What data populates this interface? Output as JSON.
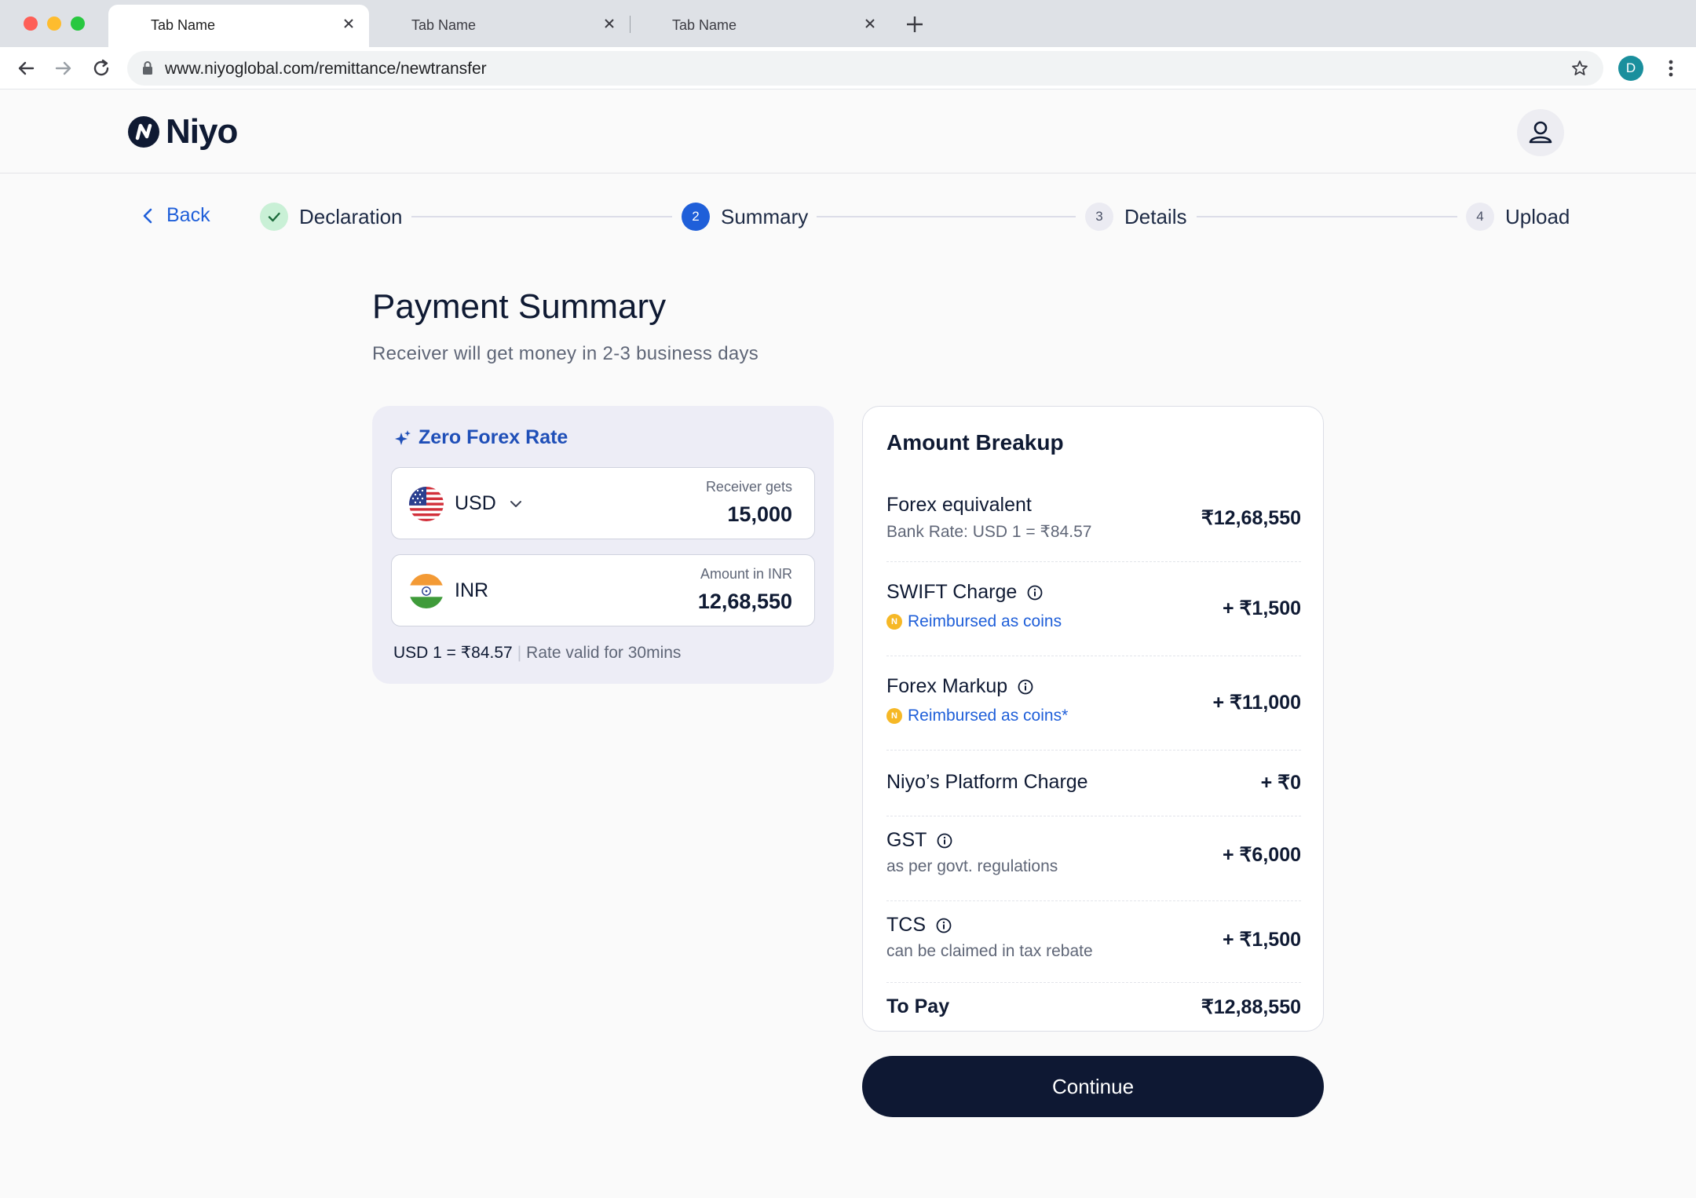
{
  "browser": {
    "tabs": [
      {
        "title": "Tab Name",
        "active": true
      },
      {
        "title": "Tab Name",
        "active": false
      },
      {
        "title": "Tab Name",
        "active": false
      }
    ],
    "url": "www.niyoglobal.com/remittance/newtransfer",
    "profile_initial": "D"
  },
  "header": {
    "logo_text": "Niyo"
  },
  "stepper": {
    "back_label": "Back",
    "steps": [
      {
        "number": "1",
        "label": "Declaration",
        "state": "done"
      },
      {
        "number": "2",
        "label": "Summary",
        "state": "active"
      },
      {
        "number": "3",
        "label": "Details",
        "state": "pending"
      },
      {
        "number": "4",
        "label": "Upload",
        "state": "pending"
      }
    ]
  },
  "page": {
    "title": "Payment Summary",
    "subtitle": "Receiver will get money in 2-3 business days"
  },
  "forex": {
    "heading": "Zero Forex Rate",
    "send": {
      "currency": "USD",
      "caption": "Receiver gets",
      "amount": "15,000"
    },
    "receive": {
      "currency": "INR",
      "caption": "Amount in INR",
      "amount": "12,68,550"
    },
    "rate": "USD 1 = ₹84.57",
    "rate_validity": "Rate valid for 30mins"
  },
  "breakup": {
    "title": "Amount Breakup",
    "rows": [
      {
        "label": "Forex equivalent",
        "sub": "Bank Rate: USD 1 = ₹84.57",
        "amount": "₹12,68,550"
      },
      {
        "label": "SWIFT Charge",
        "coin_note": "Reimbursed as coins",
        "amount": "+ ₹1,500"
      },
      {
        "label": "Forex Markup",
        "coin_note": "Reimbursed as coins*",
        "amount": "+ ₹11,000"
      },
      {
        "label": "Niyo’s Platform Charge",
        "amount": "+ ₹0"
      },
      {
        "label": "GST",
        "sub": "as per govt. regulations",
        "amount": "+ ₹6,000"
      },
      {
        "label": "TCS",
        "sub": "can be claimed in tax rebate",
        "amount": "+ ₹1,500"
      }
    ],
    "total": {
      "label": "To Pay",
      "amount": "₹12,88,550"
    }
  },
  "actions": {
    "continue_label": "Continue"
  },
  "colors": {
    "primary_dark": "#0e1833",
    "accent_blue": "#1f5fd9",
    "success_bg": "#c9f0d6",
    "coin": "#f6b826"
  }
}
